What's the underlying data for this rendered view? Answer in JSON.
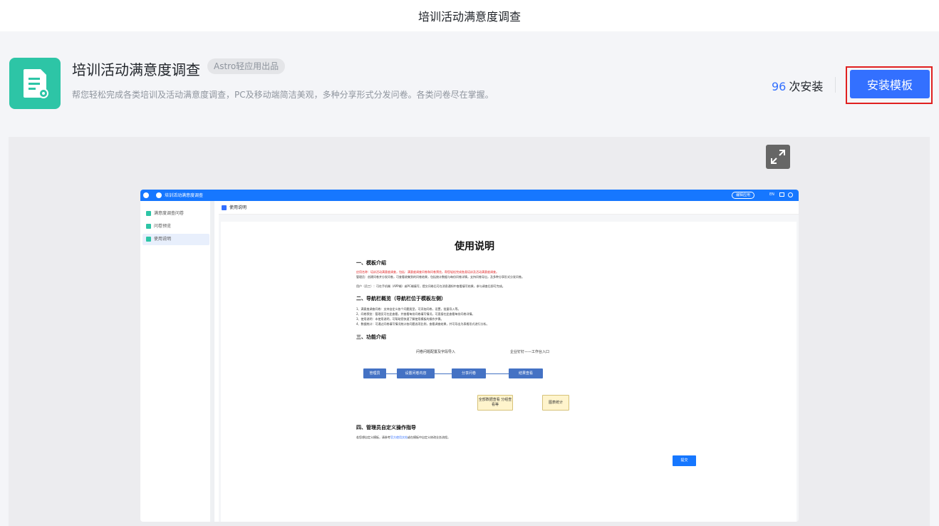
{
  "topbar": {
    "title": "培训活动满意度调查"
  },
  "header": {
    "app_title": "培训活动满意度调查",
    "badge": "Astro轻应用出品",
    "description": "帮您轻松完成各类培训及活动满意度调查，PC及移动端简洁美观，多种分享形式分发问卷。各类问卷尽在掌握。",
    "install_count": "96",
    "install_suffix": "次安装",
    "install_button": "安装模板",
    "icon": "document-gear-icon",
    "accent_color": "#2dc5a6",
    "button_color": "#3370ff"
  },
  "preview": {
    "expand_icon": "expand-arrows-icon",
    "topbar": {
      "title": "培训活动满意度调查",
      "edit_label": "编辑应用",
      "lang": "EN"
    },
    "sidebar": [
      {
        "label": "满意度调查问卷"
      },
      {
        "label": "问卷预览"
      },
      {
        "label": "使用说明"
      }
    ],
    "crumb": "使用说明",
    "doc": {
      "title": "使用说明",
      "s1": "一、模板介绍",
      "s1_red": "应用名称：培训活动满意度调查，包括：满意度调查问卷和问卷预览，帮您轻松完成各类培训及活动满意度调查。",
      "s1_l1": "管理员：创建问卷并分发问卷，可查看收集到的问卷结果，包括统计数据与每份问卷详情，支持问卷导出，及多种分享形式分发问卷。",
      "s1_l2": "用户（员工）：可在手机端（APP端）或PC端填写，提交问卷后可在消息通知中查看填写结果，参与调查后即可完成。",
      "s2": "二、导航栏概览（导航栏位于模板左侧）",
      "s2_l1": "1、满意度调查问卷：支持自定义各个问题类型，可添加问卷，设置，批量导入等。",
      "s2_l2": "2、问卷预览：管理员可在此查看，并查看每份问卷填写情况，可直接在此查看每份问卷详情。",
      "s2_l3": "3、使用说明：本使用说明，可帮助您快速了解使用模板的操作步骤。",
      "s2_l4": "4、数据统计：可通过问卷填写情况统计各问题选项比例，查看调查结果，并可导出为表格形式进行分析。",
      "s3": "三、功能介绍",
      "flow_note1": "问卷问题配置及字段导入",
      "flow_note2": "企业钉钉——工作台入口",
      "flow_admin": "管理员",
      "flow_setup": "设置问卷内容",
      "flow_share": "分享问卷",
      "flow_result": "结果查看",
      "flow_y1": "全部数据查看 分组查看等",
      "flow_y2": "图表统计",
      "s4": "四、管理员自定义操作指导",
      "s4_pre": "若您想自定义模板，请参考",
      "s4_link": "官方使用文档",
      "s4_post": "或在模板中自定义修改业务流程。",
      "submit": "提交"
    }
  }
}
